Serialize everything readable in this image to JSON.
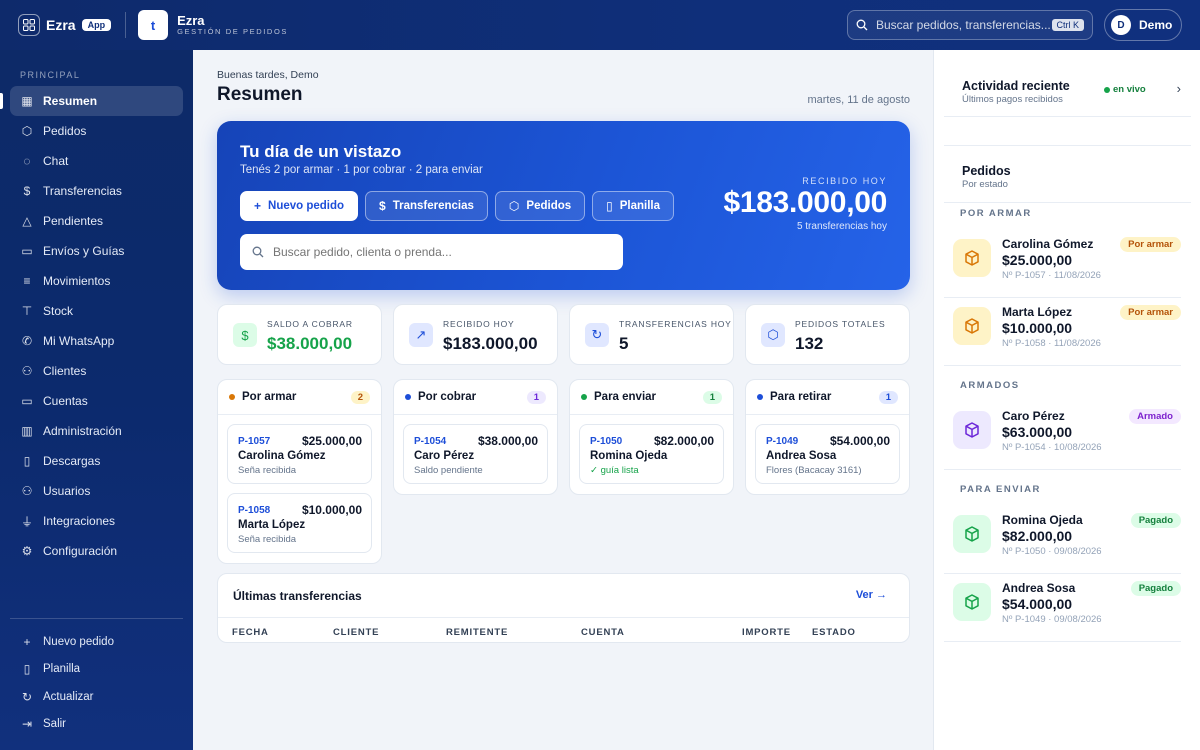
{
  "topbar": {
    "brand": "Ezra",
    "app_badge": "App",
    "project_letter": "t",
    "project_name": "Ezra",
    "project_sub": "GESTIÓN DE PEDIDOS",
    "search_placeholder": "Buscar pedidos, transferencias...",
    "search_shortcut": "Ctrl K",
    "user_initial": "D",
    "user_name": "Demo"
  },
  "sidebar": {
    "section": "PRINCIPAL",
    "items": [
      {
        "label": "Resumen",
        "icon": "grid-icon",
        "glyph": "▦",
        "active": true
      },
      {
        "label": "Pedidos",
        "icon": "box-icon",
        "glyph": "⬡"
      },
      {
        "label": "Chat",
        "icon": "chat-icon",
        "glyph": "◌"
      },
      {
        "label": "Transferencias",
        "icon": "dollar-icon",
        "glyph": "$"
      },
      {
        "label": "Pendientes",
        "icon": "alert-icon",
        "glyph": "△"
      },
      {
        "label": "Envíos y Guías",
        "icon": "truck-icon",
        "glyph": "▭"
      },
      {
        "label": "Movimientos",
        "icon": "list-icon",
        "glyph": "≡"
      },
      {
        "label": "Stock",
        "icon": "shirt-icon",
        "glyph": "⊤"
      },
      {
        "label": "Mi WhatsApp",
        "icon": "phone-icon",
        "glyph": "✆"
      },
      {
        "label": "Clientes",
        "icon": "users-icon",
        "glyph": "⚇"
      },
      {
        "label": "Cuentas",
        "icon": "card-icon",
        "glyph": "▭"
      },
      {
        "label": "Administración",
        "icon": "chart-icon",
        "glyph": "▥"
      },
      {
        "label": "Descargas",
        "icon": "file-icon",
        "glyph": "▯"
      },
      {
        "label": "Usuarios",
        "icon": "user-group-icon",
        "glyph": "⚇"
      },
      {
        "label": "Integraciones",
        "icon": "plug-icon",
        "glyph": "⏚"
      },
      {
        "label": "Configuración",
        "icon": "gear-icon",
        "glyph": "⚙"
      }
    ],
    "bottom": [
      {
        "label": "Nuevo pedido",
        "icon": "plus-icon",
        "glyph": "+"
      },
      {
        "label": "Planilla",
        "icon": "file-icon",
        "glyph": "▯"
      },
      {
        "label": "Actualizar",
        "icon": "refresh-icon",
        "glyph": "↻"
      },
      {
        "label": "Salir",
        "icon": "logout-icon",
        "glyph": "⇥"
      }
    ]
  },
  "main": {
    "greeting": "Buenas tardes, Demo",
    "title": "Resumen",
    "date": "martes, 11 de agosto",
    "hero": {
      "title": "Tu día de un vistazo",
      "subtitle": "Tenés 2 por armar · 1 por cobrar · 2 para enviar",
      "buttons": [
        {
          "label": "Nuevo pedido",
          "glyph": "+",
          "icon": "plus-icon"
        },
        {
          "label": "Transferencias",
          "glyph": "$",
          "icon": "dollar-icon"
        },
        {
          "label": "Pedidos",
          "glyph": "⬡",
          "icon": "box-icon"
        },
        {
          "label": "Planilla",
          "glyph": "▯",
          "icon": "file-icon"
        }
      ],
      "search_placeholder": "Buscar pedido, clienta o prenda...",
      "received_label": "RECIBIDO HOY",
      "received_amount": "$183.000,00",
      "received_note": "5 transferencias hoy"
    },
    "stats": [
      {
        "label": "SALDO A COBRAR",
        "value": "$38.000,00",
        "glyph": "$",
        "icon": "dollar-icon",
        "color": "#16a34a",
        "bg": "#dcfce7"
      },
      {
        "label": "RECIBIDO HOY",
        "value": "$183.000,00",
        "glyph": "↗",
        "icon": "trend-up-icon",
        "color": "#1d4ed8",
        "bg": "#e0e7ff"
      },
      {
        "label": "TRANSFERENCIAS HOY",
        "value": "5",
        "glyph": "↻",
        "icon": "refresh-icon",
        "color": "#1d4ed8",
        "bg": "#e0e7ff"
      },
      {
        "label": "PEDIDOS TOTALES",
        "value": "132",
        "glyph": "⬡",
        "icon": "box-icon",
        "color": "#1d4ed8",
        "bg": "#e0e7ff"
      }
    ],
    "columns": [
      {
        "title": "Por armar",
        "count": "2",
        "dot": "#d97706",
        "cnt_bg": "#fef3c7",
        "cnt_color": "#b45309",
        "cards": [
          {
            "id": "P-1057",
            "amount": "$25.000,00",
            "name": "Carolina Gómez",
            "note": "Seña recibida"
          },
          {
            "id": "P-1058",
            "amount": "$10.000,00",
            "name": "Marta López",
            "note": "Seña recibida"
          }
        ]
      },
      {
        "title": "Por cobrar",
        "count": "1",
        "dot": "#1d4ed8",
        "cnt_bg": "#ede9fe",
        "cnt_color": "#6d28d9",
        "cards": [
          {
            "id": "P-1054",
            "amount": "$38.000,00",
            "name": "Caro Pérez",
            "note": "Saldo pendiente"
          }
        ]
      },
      {
        "title": "Para enviar",
        "count": "1",
        "dot": "#16a34a",
        "cnt_bg": "#dcfce7",
        "cnt_color": "#15803d",
        "cards": [
          {
            "id": "P-1050",
            "amount": "$82.000,00",
            "name": "Romina Ojeda",
            "note": "✓ guía lista",
            "ok": true
          }
        ]
      },
      {
        "title": "Para retirar",
        "count": "1",
        "dot": "#1d4ed8",
        "cnt_bg": "#e0e7ff",
        "cnt_color": "#1d4ed8",
        "cards": [
          {
            "id": "P-1049",
            "amount": "$54.000,00",
            "name": "Andrea Sosa",
            "note": "Flores (Bacacay 3161)"
          }
        ]
      }
    ],
    "transfers": {
      "title": "Últimas transferencias",
      "link": "Ver →",
      "headers": [
        "FECHA",
        "CLIENTE",
        "REMITENTE",
        "CUENTA",
        "IMPORTE",
        "ESTADO"
      ]
    }
  },
  "right": {
    "activity_title": "Actividad reciente",
    "activity_sub": "Últimos pagos recibidos",
    "live": "en vivo",
    "orders_title": "Pedidos",
    "orders_sub": "Por estado",
    "groups": [
      {
        "label": "POR ARMAR",
        "items": [
          {
            "name": "Carolina Gómez",
            "amount": "$25.000,00",
            "meta": "Nº P-1057 · 11/08/2026",
            "tag": "Por armar",
            "tag_bg": "#fef3c7",
            "tag_color": "#b45309",
            "ico_bg": "#fef3c7",
            "ico_color": "#d97706"
          },
          {
            "name": "Marta López",
            "amount": "$10.000,00",
            "meta": "Nº P-1058 · 11/08/2026",
            "tag": "Por armar",
            "tag_bg": "#fef3c7",
            "tag_color": "#b45309",
            "ico_bg": "#fef3c7",
            "ico_color": "#d97706"
          }
        ]
      },
      {
        "label": "ARMADOS",
        "items": [
          {
            "name": "Caro Pérez",
            "amount": "$63.000,00",
            "meta": "Nº P-1054 · 10/08/2026",
            "tag": "Armado",
            "tag_bg": "#f3e8ff",
            "tag_color": "#7e22ce",
            "ico_bg": "#ede9fe",
            "ico_color": "#6d28d9"
          }
        ]
      },
      {
        "label": "PARA ENVIAR",
        "items": [
          {
            "name": "Romina Ojeda",
            "amount": "$82.000,00",
            "meta": "Nº P-1050 · 09/08/2026",
            "tag": "Pagado",
            "tag_bg": "#dcfce7",
            "tag_color": "#15803d",
            "ico_bg": "#dcfce7",
            "ico_color": "#16a34a"
          },
          {
            "name": "Andrea Sosa",
            "amount": "$54.000,00",
            "meta": "Nº P-1049 · 09/08/2026",
            "tag": "Pagado",
            "tag_bg": "#dcfce7",
            "tag_color": "#15803d",
            "ico_bg": "#dcfce7",
            "ico_color": "#16a34a"
          }
        ]
      }
    ]
  }
}
